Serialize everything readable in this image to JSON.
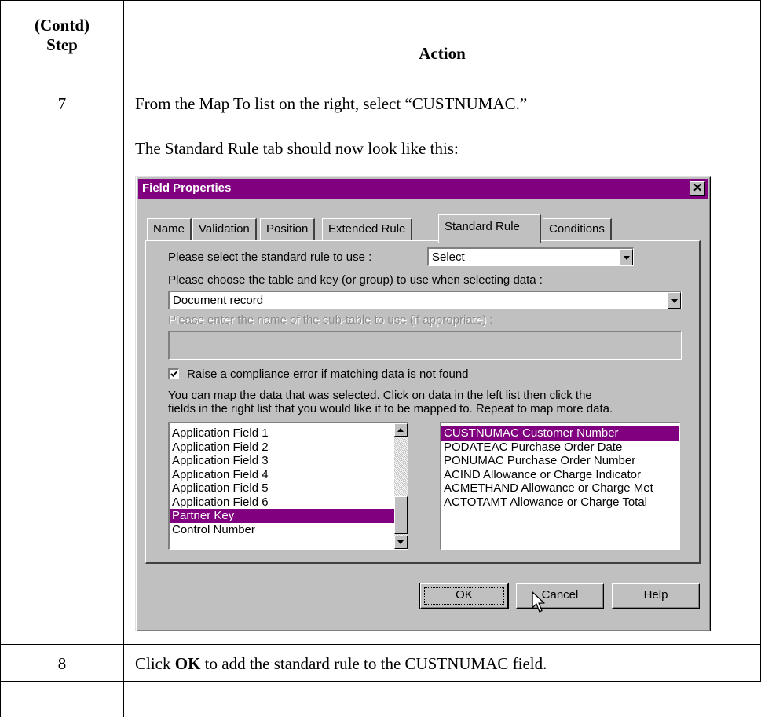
{
  "table": {
    "header_step_line1": "(Contd)",
    "header_step_line2": "Step",
    "header_action": "Action"
  },
  "steps": [
    {
      "number": "7",
      "text1": "From the Map To list on the right, select “CUSTNUMAC.”",
      "text2": "The Standard Rule tab should now look like this:"
    },
    {
      "number": "8",
      "text_before": "Click ",
      "text_bold": "OK",
      "text_after": " to add the standard rule to the CUSTNUMAC field."
    }
  ],
  "dialog": {
    "title": "Field Properties",
    "close_glyph": "✕",
    "tabs": [
      "Name",
      "Validation",
      "Position",
      "Extended Rule",
      "Standard Rule",
      "Conditions"
    ],
    "active_tab": "Standard Rule",
    "rule_label": "Please select the standard rule to use :",
    "rule_value": "Select",
    "table_label": "Please choose the table and key (or group) to use when selecting data :",
    "table_value": "Document record",
    "subtable_label": "Please enter the name of the sub-table to use (if appropriate) :",
    "subtable_value": "",
    "compliance_checked": true,
    "compliance_label": "Raise a compliance error if matching data is not found",
    "map_instructions_line1": "You can map the data that was selected. Click on data in the left list then click the",
    "map_instructions_line2": "fields in the right list that you would like it to be mapped to. Repeat to map more data.",
    "left_list": [
      "Application Field 1",
      "Application Field 2",
      "Application Field 3",
      "Application Field 4",
      "Application Field 5",
      "Application Field 6",
      "Partner Key",
      "Control Number"
    ],
    "left_selected": "Partner Key",
    "right_list": [
      "CUSTNUMAC Customer Number",
      "PODATEAC Purchase Order Date",
      "PONUMAC Purchase Order Number",
      "ACIND Allowance or Charge Indicator",
      "ACMETHAND Allowance or Charge Met",
      "ACTOTAMT Allowance or Charge Total"
    ],
    "right_selected": "CUSTNUMAC Customer Number",
    "ok_label": "OK",
    "cancel_label": "Cancel",
    "help_label": "Help",
    "accent_color": "#800080"
  }
}
